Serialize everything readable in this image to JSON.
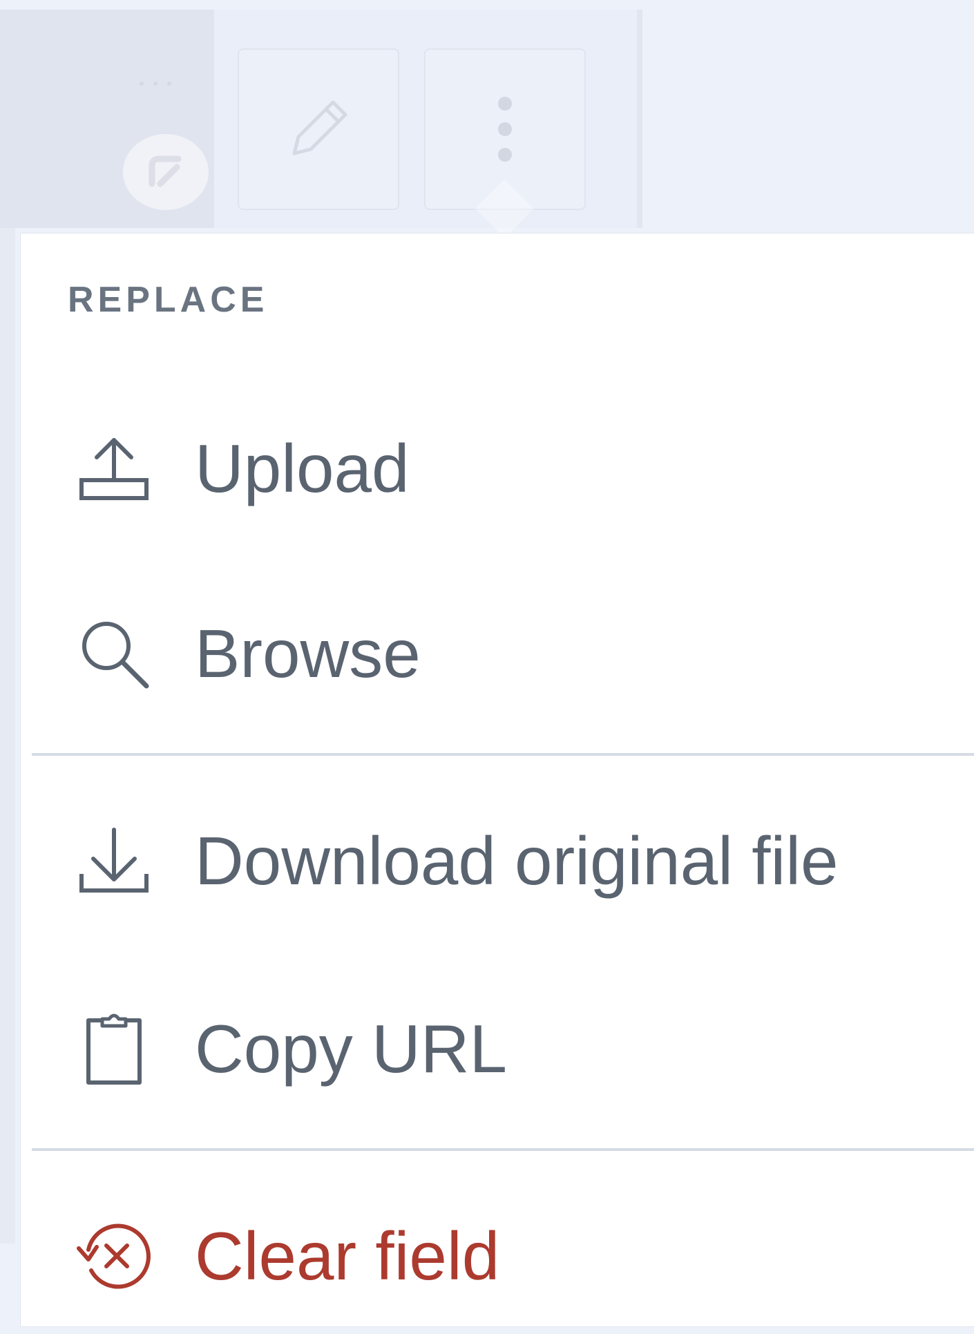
{
  "menu": {
    "section_label": "REPLACE",
    "items": [
      {
        "label": "Upload",
        "icon": "upload-icon"
      },
      {
        "label": "Browse",
        "icon": "search-icon"
      },
      {
        "label": "Download original file",
        "icon": "download-icon"
      },
      {
        "label": "Copy URL",
        "icon": "clipboard-icon"
      },
      {
        "label": "Clear field",
        "icon": "clear-field-icon"
      }
    ]
  },
  "colors": {
    "text": "#5a6470",
    "section_label": "#6a7481",
    "danger": "#ac3a2e",
    "divider": "#d5dbe3",
    "backdrop": "#edf1fa"
  }
}
